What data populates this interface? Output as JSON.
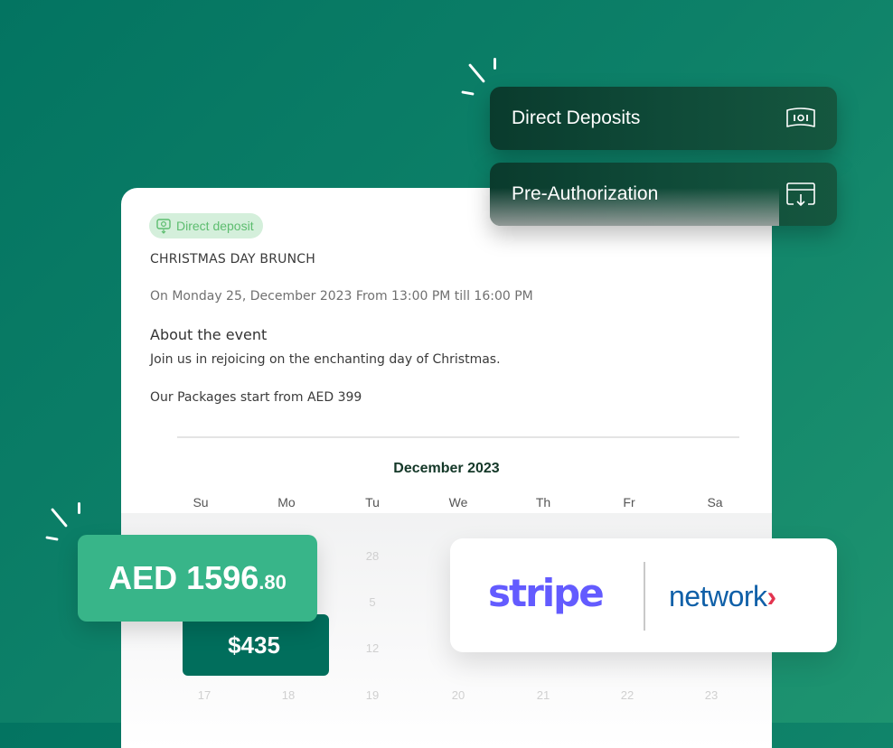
{
  "payment_methods": [
    {
      "label": "Direct Deposits",
      "icon": "banknote-icon"
    },
    {
      "label": "Pre-Authorization",
      "icon": "card-download-icon"
    }
  ],
  "event": {
    "badge": "Direct deposit",
    "title": "CHRISTMAS DAY BRUNCH",
    "date": "On Monday 25, December 2023 From 13:00 PM till 16:00 PM",
    "about_heading": "About the event",
    "about_text": "Join us in rejoicing on the enchanting day of Christmas.",
    "packages": "Our Packages start from AED 399"
  },
  "calendar": {
    "month": "December 2023",
    "weekdays": [
      "Su",
      "Mo",
      "Tu",
      "We",
      "Th",
      "Fr",
      "Sa"
    ],
    "visible_days": {
      "row1": [
        "28"
      ],
      "row2": [
        "5"
      ],
      "row3": [
        "12"
      ],
      "row4": [
        "17",
        "18",
        "19",
        "20",
        "21",
        "22",
        "23"
      ]
    }
  },
  "prices": {
    "aed_main": "AED 1596",
    "aed_decimal": ".80",
    "usd": "$435"
  },
  "partners": {
    "stripe": "stripe",
    "network": "network",
    "network_chevron": "›"
  },
  "colors": {
    "background": "#037461",
    "aed_tag": "#38b589",
    "usd_tag": "#016e5c",
    "stripe": "#635bff",
    "network": "#1060a8",
    "network_accent": "#e3344f",
    "badge_text": "#5dbd6f"
  }
}
